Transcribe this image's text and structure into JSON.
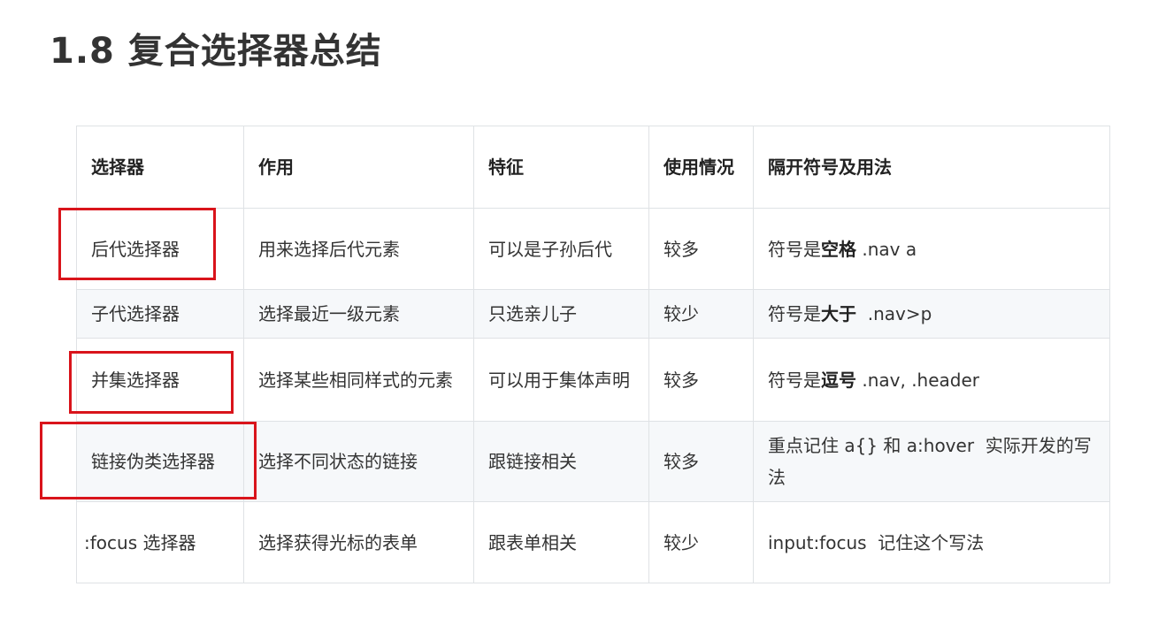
{
  "title": "1.8 复合选择器总结",
  "table": {
    "headers": [
      "选择器",
      "作用",
      "特征",
      "使用情况",
      "隔开符号及用法"
    ],
    "rows": [
      {
        "selector": "后代选择器",
        "purpose": "用来选择后代元素",
        "feature": "可以是子孙后代",
        "usage": "较多",
        "separator": {
          "prefix": "符号是",
          "key": "空格",
          "suffix": " .nav a"
        }
      },
      {
        "selector": "子代选择器",
        "purpose": "选择最近一级元素",
        "feature": "只选亲儿子",
        "usage": "较少",
        "separator": {
          "prefix": "符号是",
          "key": "大于",
          "suffix": "  .nav>p"
        }
      },
      {
        "selector": "并集选择器",
        "purpose": "选择某些相同样式的元素",
        "feature": "可以用于集体声明",
        "usage": "较多",
        "separator": {
          "prefix": "符号是",
          "key": "逗号",
          "suffix": " .nav, .header"
        }
      },
      {
        "selector": "链接伪类选择器",
        "purpose": "选择不同状态的链接",
        "feature": "跟链接相关",
        "usage": "较多",
        "separator": {
          "prefix": "重点记住 a{} 和 a:hover  实际开发的写法",
          "key": "",
          "suffix": ""
        }
      },
      {
        "selector": ":focus 选择器",
        "purpose": "选择获得光标的表单",
        "feature": "跟表单相关",
        "usage": "较少",
        "separator": {
          "prefix": "input:focus  记住这个写法",
          "key": "",
          "suffix": ""
        }
      }
    ]
  },
  "colors": {
    "highlight": "#d9141b",
    "stripe": "#f6f8fa",
    "border": "#dfe2e5",
    "text": "#333333"
  }
}
